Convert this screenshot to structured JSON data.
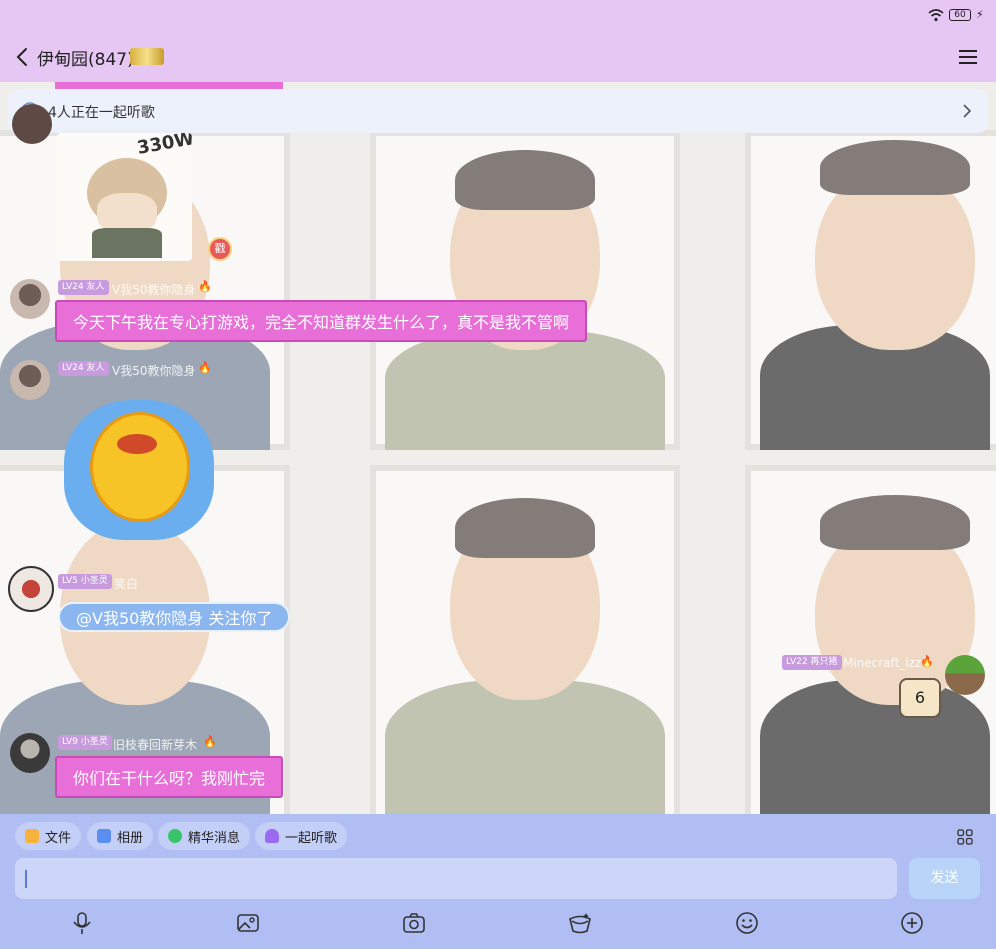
{
  "status": {
    "battery": "60"
  },
  "header": {
    "title": "伊甸园(847)"
  },
  "listen_bar": {
    "text": "4人正在一起听歌"
  },
  "messages": [
    {
      "level": "LV24 友人",
      "nickname": "V我50教你隐身",
      "text": "今天下午我在专心打游戏，完全不知道群发生什么了，真不是我不管啊"
    },
    {
      "level": "LV24 友人",
      "nickname": "V我50教你隐身",
      "text": ""
    },
    {
      "level": "LV5 小圣灵",
      "nickname": "笑白",
      "text": "@V我50教你隐身 关注你了"
    },
    {
      "level": "LV22 再只猪",
      "nickname": "Minecraft_lzz",
      "text": "6"
    },
    {
      "level": "LV9 小圣灵",
      "nickname": "旧枝春回新芽木",
      "text": "你们在干什么呀？我刚忙完"
    }
  ],
  "toolbar": {
    "chips": [
      {
        "label": "文件"
      },
      {
        "label": "相册"
      },
      {
        "label": "精华消息"
      },
      {
        "label": "一起听歌"
      }
    ],
    "send_label": "发送"
  },
  "colors": {
    "header_bg": "#e6c6f2",
    "bubble": "#e86fd8",
    "bottom_bg": "#b0bef4"
  }
}
